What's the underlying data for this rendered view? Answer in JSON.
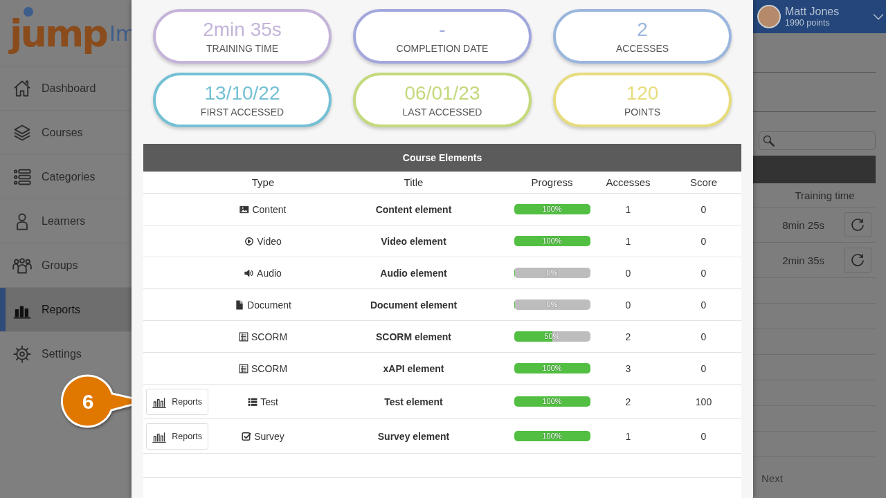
{
  "logo": {
    "text": "jump",
    "cut_text": "Im"
  },
  "sidebar": {
    "items": [
      {
        "label": "Dashboard",
        "selected": false
      },
      {
        "label": "Courses",
        "selected": false
      },
      {
        "label": "Categories",
        "selected": false
      },
      {
        "label": "Learners",
        "selected": false
      },
      {
        "label": "Groups",
        "selected": false
      },
      {
        "label": "Reports",
        "selected": true
      },
      {
        "label": "Settings",
        "selected": false
      }
    ]
  },
  "user": {
    "name": "Matt Jones",
    "points": "1990 points"
  },
  "background_table": {
    "column": "Training time",
    "rows": [
      {
        "training_time": "8min 25s"
      },
      {
        "training_time": "2min 35s"
      }
    ],
    "next": "Next"
  },
  "stats": [
    {
      "value": "2min 35s",
      "label": "TRAINING TIME",
      "color": "#c4b4d9"
    },
    {
      "value": "-",
      "label": "COMPLETION DATE",
      "color": "#a2a7dc"
    },
    {
      "value": "2",
      "label": "ACCESSES",
      "color": "#9ab6dd"
    },
    {
      "value": "13/10/22",
      "label": "FIRST ACCESSED",
      "color": "#74c0d4"
    },
    {
      "value": "06/01/23",
      "label": "LAST ACCESSED",
      "color": "#c3d97b"
    },
    {
      "value": "120",
      "label": "POINTS",
      "color": "#e7dc7c"
    }
  ],
  "course_elements": {
    "title": "Course Elements",
    "columns": [
      "Type",
      "Title",
      "Progress",
      "Accesses",
      "Score"
    ],
    "rows": [
      {
        "kind": "content",
        "type": "Content",
        "title": "Content element",
        "progress": "100%",
        "level": 1,
        "accesses": "1",
        "score": "0"
      },
      {
        "kind": "video",
        "type": "Video",
        "title": "Video element",
        "progress": "100%",
        "level": 1,
        "accesses": "1",
        "score": "0"
      },
      {
        "kind": "audio",
        "type": "Audio",
        "title": "Audio element",
        "progress": "0%",
        "level": 0,
        "accesses": "0",
        "score": "0"
      },
      {
        "kind": "document",
        "type": "Document",
        "title": "Document element",
        "progress": "0%",
        "level": 0,
        "accesses": "0",
        "score": "0"
      },
      {
        "kind": "scorm",
        "type": "SCORM",
        "title": "SCORM element",
        "progress": "50%",
        "level": 0.5,
        "accesses": "2",
        "score": "0"
      },
      {
        "kind": "scorm",
        "type": "SCORM",
        "title": "xAPI element",
        "progress": "100%",
        "level": 1,
        "accesses": "3",
        "score": "0"
      },
      {
        "kind": "test",
        "type": "Test",
        "title": "Test element",
        "progress": "100%",
        "level": 1,
        "accesses": "2",
        "score": "100",
        "reports": "Reports"
      },
      {
        "kind": "survey",
        "type": "Survey",
        "title": "Survey element",
        "progress": "100%",
        "level": 1,
        "accesses": "1",
        "score": "0",
        "reports": "Reports"
      }
    ]
  },
  "callout": {
    "label": "6"
  }
}
